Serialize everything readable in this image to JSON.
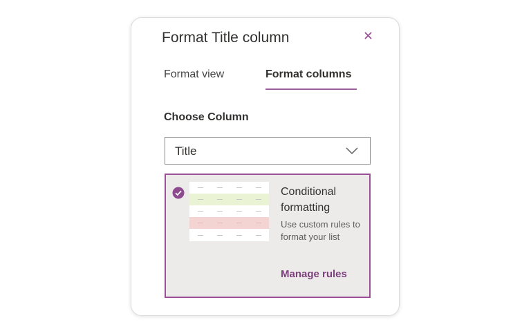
{
  "panel": {
    "title": "Format Title column",
    "close_icon": "close-icon"
  },
  "tabs": [
    {
      "label": "Format view",
      "selected": false
    },
    {
      "label": "Format columns",
      "selected": true
    }
  ],
  "choose_column": {
    "label": "Choose Column",
    "selected_value": "Title",
    "icon": "chevron-down-icon"
  },
  "option": {
    "selected": true,
    "title": "Conditional formatting",
    "description": "Use custom rules to format your list",
    "link": "Manage rules",
    "icon": "checkmark-circle-icon"
  },
  "colors": {
    "accent": "#9b4f96",
    "highlight_green": "#eaf3d3",
    "highlight_red": "#f4d3d3"
  }
}
